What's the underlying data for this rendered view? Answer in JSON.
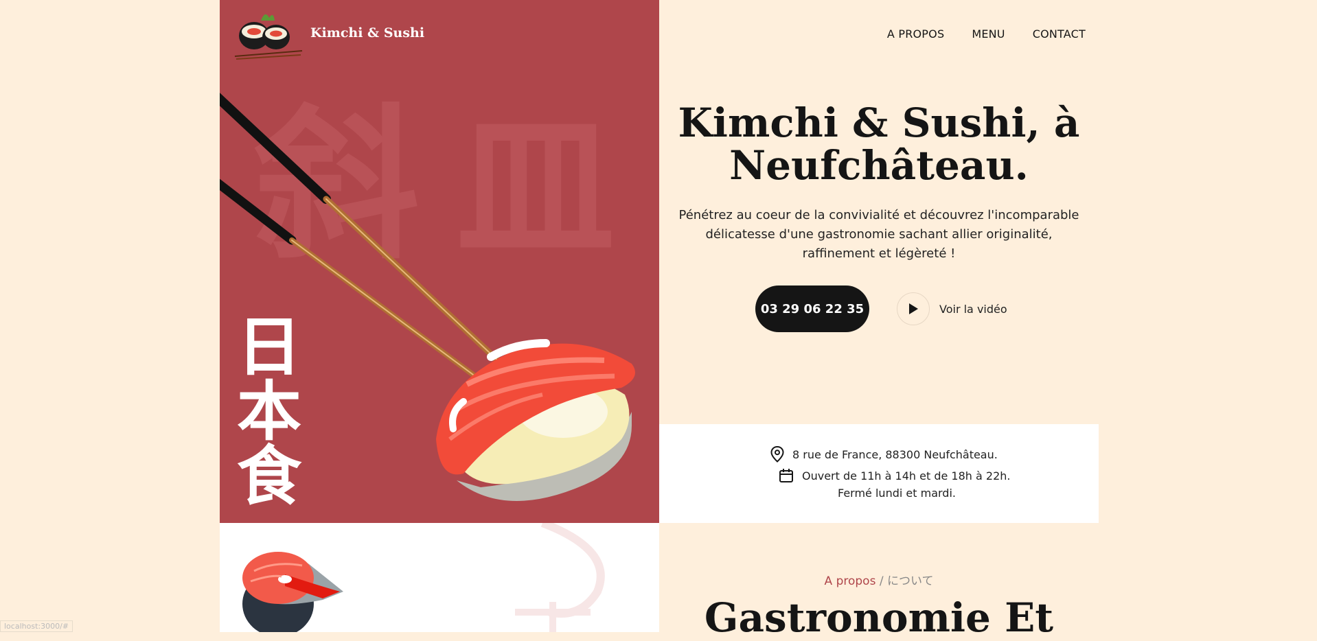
{
  "header": {
    "brand": "Kimchi & Sushi",
    "nav": [
      "A PROPOS",
      "MENU",
      "CONTACT"
    ]
  },
  "hero": {
    "title": "Kimchi & Sushi, à Neufchâteau.",
    "description": "Pénétrez au coeur de la convivialité et découvrez l'incomparable délicatesse d'une gastronomie sachant allier originalité, raffinement et légèreté !",
    "phone": "03 29 06 22 35",
    "video_label": "Voir la vidéo",
    "vertical_kanji": [
      "日",
      "本",
      "食"
    ],
    "ghost_kanji": [
      "斜",
      "皿"
    ]
  },
  "info": {
    "address": "8 rue de France, 88300 Neufchâteau.",
    "hours": "Ouvert de 11h à 14h et de 18h à 22h.",
    "closed": "Fermé lundi et mardi."
  },
  "about": {
    "label_fr": "A propos",
    "separator": " / ",
    "label_jp": "について",
    "title": "Gastronomie Et"
  },
  "status_bar": "localhost:3000/#",
  "colors": {
    "page_background": "#FEEFDC",
    "panel_red": "#AF464B",
    "dark": "#151515",
    "white": "#FFFFFF"
  },
  "icons": [
    "sushi-logo-icon",
    "play-icon",
    "location-pin-icon",
    "calendar-icon"
  ]
}
